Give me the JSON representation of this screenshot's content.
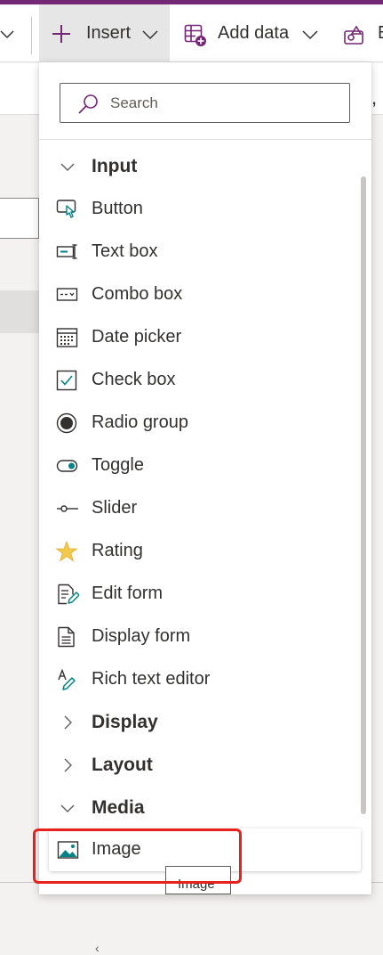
{
  "colors": {
    "brand": "#742774",
    "accent_teal": "#038387",
    "star": "#f2c94c",
    "highlight": "#e8211c"
  },
  "toolbar": {
    "insert_label": "Insert",
    "add_data_label": "Add data",
    "next_label": "E",
    "icons": {
      "left_chevron": "chevron-down-icon",
      "insert": "plus-icon",
      "add_data": "table-add-icon",
      "next": "shapes-icon"
    }
  },
  "background": {
    "right_glyph": ","
  },
  "insert_panel": {
    "search": {
      "placeholder": "Search",
      "value": "",
      "icon": "search-icon"
    },
    "items": [
      {
        "label": "Input",
        "type": "category",
        "expanded": true,
        "icon": "chevron-down-icon"
      },
      {
        "label": "Button",
        "type": "item",
        "icon": "button-icon"
      },
      {
        "label": "Text box",
        "type": "item",
        "icon": "text-box-icon"
      },
      {
        "label": "Combo box",
        "type": "item",
        "icon": "combo-box-icon"
      },
      {
        "label": "Date picker",
        "type": "item",
        "icon": "calendar-icon"
      },
      {
        "label": "Check box",
        "type": "item",
        "icon": "checkbox-icon"
      },
      {
        "label": "Radio group",
        "type": "item",
        "icon": "radio-icon"
      },
      {
        "label": "Toggle",
        "type": "item",
        "icon": "toggle-icon"
      },
      {
        "label": "Slider",
        "type": "item",
        "icon": "slider-icon"
      },
      {
        "label": "Rating",
        "type": "item",
        "icon": "star-icon"
      },
      {
        "label": "Edit form",
        "type": "item",
        "icon": "edit-form-icon"
      },
      {
        "label": "Display form",
        "type": "item",
        "icon": "document-icon"
      },
      {
        "label": "Rich text editor",
        "type": "item",
        "icon": "rich-text-icon"
      },
      {
        "label": "Display",
        "type": "category",
        "expanded": false,
        "icon": "chevron-right-icon"
      },
      {
        "label": "Layout",
        "type": "category",
        "expanded": false,
        "icon": "chevron-right-icon"
      },
      {
        "label": "Media",
        "type": "category",
        "expanded": true,
        "icon": "chevron-down-icon"
      }
    ],
    "focused_item": {
      "label": "Image",
      "icon": "image-icon"
    }
  },
  "tooltip": {
    "text": "Image"
  }
}
